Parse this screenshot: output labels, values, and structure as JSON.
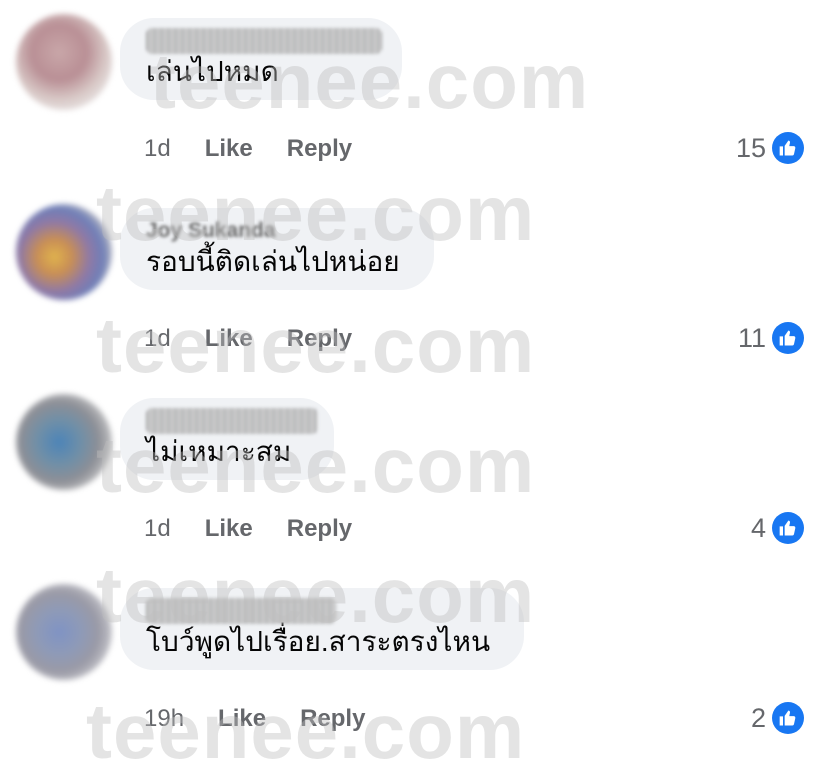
{
  "watermark_text": "teenee.com",
  "colors": {
    "bubble_bg": "#f0f2f5",
    "meta_text": "#65676b",
    "like_blue": "#1877f2"
  },
  "comments": [
    {
      "name": "",
      "text": "เล่นไปหมด",
      "time": "1d",
      "like_label": "Like",
      "reply_label": "Reply",
      "reaction_count": "15",
      "reaction_icon": "like-icon"
    },
    {
      "name": "Joy Sukanda",
      "text": "รอบนี้ติดเล่นไปหน่อย",
      "time": "1d",
      "like_label": "Like",
      "reply_label": "Reply",
      "reaction_count": "11",
      "reaction_icon": "like-icon"
    },
    {
      "name": "",
      "text": "ไม่เหมาะสม",
      "time": "1d",
      "like_label": "Like",
      "reply_label": "Reply",
      "reaction_count": "4",
      "reaction_icon": "like-icon"
    },
    {
      "name": "",
      "text": "โบว์พูดไปเรื่อย.สาระตรงไหน",
      "time": "19h",
      "like_label": "Like",
      "reply_label": "Reply",
      "reaction_count": "2",
      "reaction_icon": "like-icon"
    }
  ]
}
